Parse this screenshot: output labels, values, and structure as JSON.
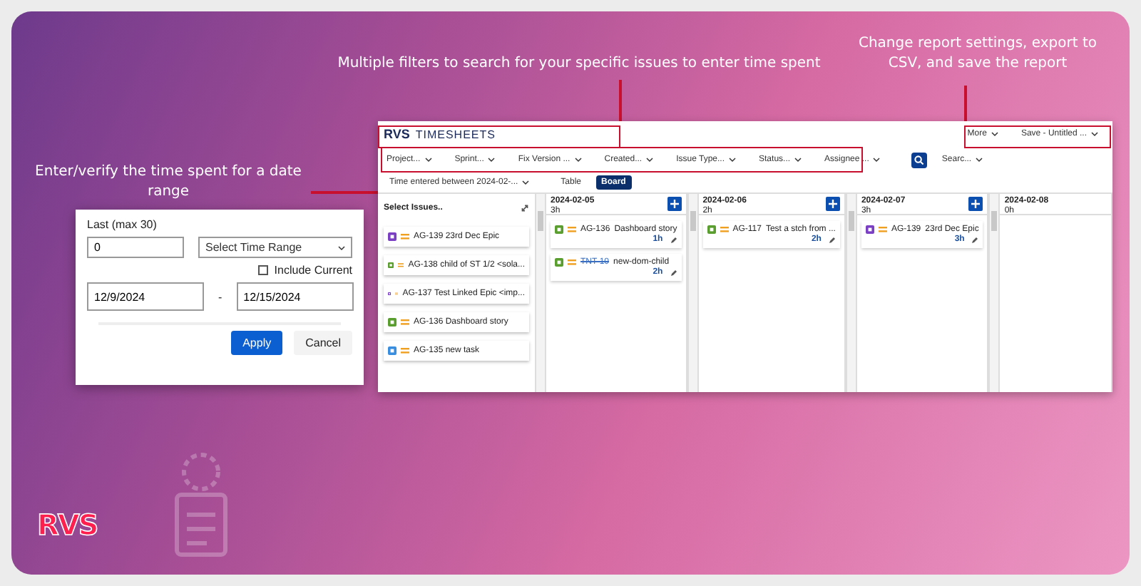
{
  "callouts": [
    {
      "text": "Multiple filters to search for your specific issues to enter time spent"
    },
    {
      "text": "Change report settings, export to CSV, and save the report"
    },
    {
      "text": "Enter/verify the time spent for a date range"
    }
  ],
  "app": {
    "brand": "RVS",
    "title": "TIMESHEETS",
    "header_buttons": [
      "More",
      "Save - Untitled ..."
    ],
    "filters": [
      "Project...",
      "Sprint...",
      "Fix Version ...",
      "Created...",
      "Issue Type...",
      "Status...",
      "Assignee ..."
    ],
    "search_menu": "Searc...",
    "time_filter": "Time entered between 2024-02-...",
    "views": [
      {
        "label": "Table",
        "selected": false
      },
      {
        "label": "Board",
        "selected": true
      }
    ],
    "issues_header": "Select Issues..",
    "issues": [
      {
        "kind": "epic",
        "text": "AG-139 23rd Dec Epic"
      },
      {
        "kind": "story",
        "text": "AG-138 child of ST 1/2 <sola..."
      },
      {
        "kind": "epic",
        "text": "AG-137 Test Linked Epic <imp..."
      },
      {
        "kind": "story",
        "text": "AG-136 Dashboard story"
      },
      {
        "kind": "task",
        "text": "AG-135 new task"
      }
    ],
    "days": [
      {
        "date": "2024-02-05",
        "total": "3h",
        "entries": [
          {
            "kind": "story",
            "key": "AG-136",
            "summary": "Dashboard story",
            "hours": "1h",
            "resolved": false
          },
          {
            "kind": "story",
            "key": "TNT-10",
            "summary": "new-dom-child",
            "hours": "2h",
            "resolved": true
          }
        ]
      },
      {
        "date": "2024-02-06",
        "total": "2h",
        "entries": [
          {
            "kind": "story",
            "key": "AG-117",
            "summary": "Test a stch from ...",
            "hours": "2h",
            "resolved": false
          }
        ]
      },
      {
        "date": "2024-02-07",
        "total": "3h",
        "entries": [
          {
            "kind": "epic",
            "key": "AG-139",
            "summary": "23rd Dec Epic",
            "hours": "3h",
            "resolved": false
          }
        ]
      },
      {
        "date": "2024-02-08",
        "total": "0h"
      }
    ]
  },
  "date_popup": {
    "label": "Last (max 30)",
    "count": "0",
    "range_select": "Select Time Range",
    "include_current": {
      "label": "Include Current",
      "checked": false
    },
    "start": "12/9/2024",
    "separator": "-",
    "end": "12/15/2024",
    "buttons": [
      "Apply",
      "Cancel"
    ]
  },
  "logo": "RVS"
}
